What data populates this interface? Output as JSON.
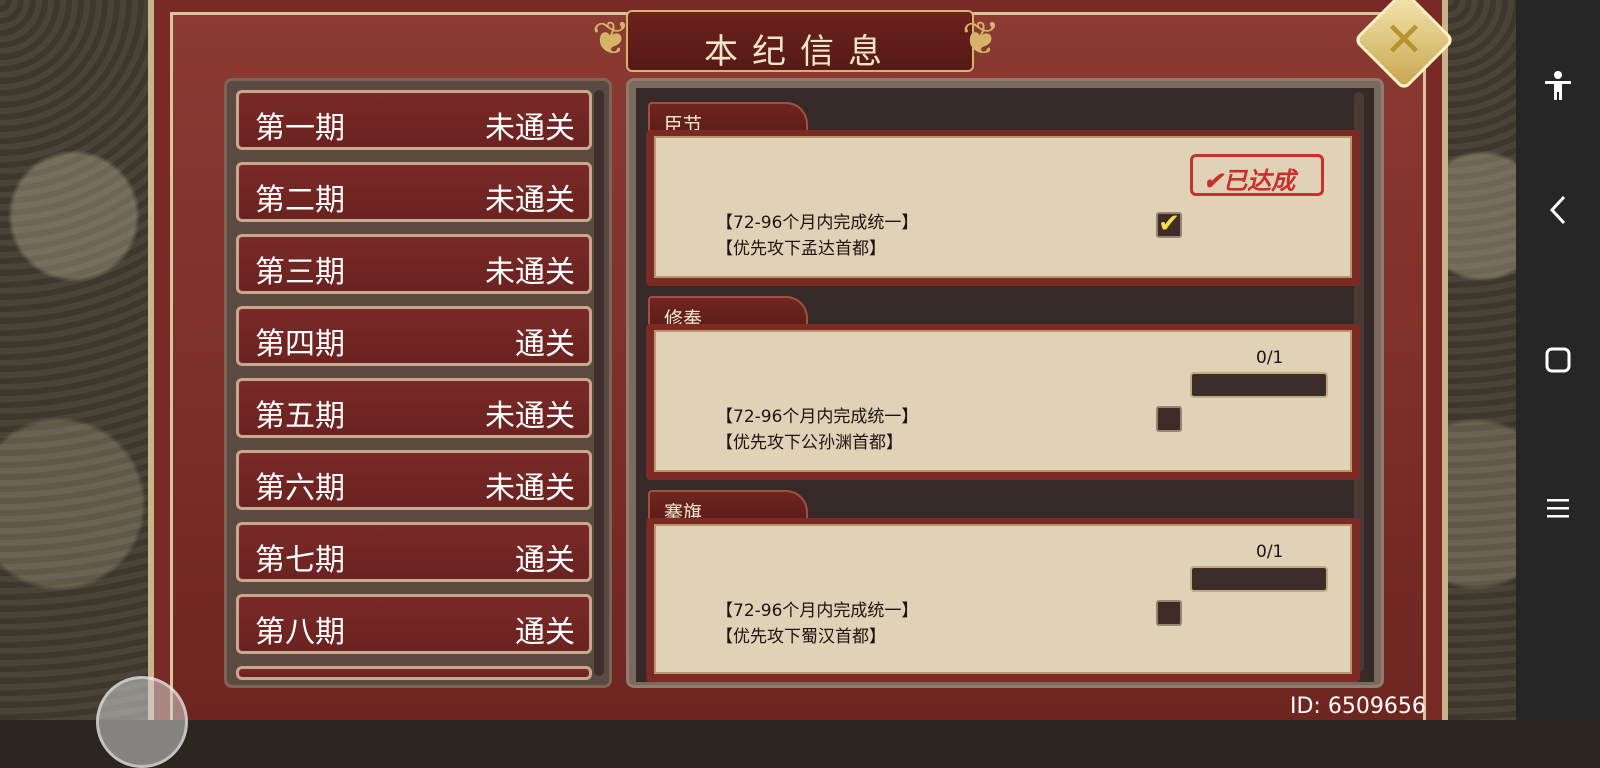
{
  "title": "本纪信息",
  "periods": [
    {
      "name": "第一期",
      "status": "未通关"
    },
    {
      "name": "第二期",
      "status": "未通关"
    },
    {
      "name": "第三期",
      "status": "未通关"
    },
    {
      "name": "第四期",
      "status": "通关"
    },
    {
      "name": "第五期",
      "status": "未通关"
    },
    {
      "name": "第六期",
      "status": "未通关"
    },
    {
      "name": "第七期",
      "status": "通关"
    },
    {
      "name": "第八期",
      "status": "通关"
    }
  ],
  "objectives": [
    {
      "tab": "臣节",
      "line1": "【72-96个月内完成统一】",
      "line2": "【优先攻下孟达首都】",
      "achieved": true,
      "stamp_text": "✔已达成"
    },
    {
      "tab": "修奉",
      "line1": "【72-96个月内完成统一】",
      "line2": "【优先攻下公孙渊首都】",
      "achieved": false,
      "progress_text": "0/1",
      "progress_fraction": 0
    },
    {
      "tab": "搴旗",
      "line1": "【72-96个月内完成统一】",
      "line2": "【优先攻下蜀汉首都】",
      "achieved": false,
      "progress_text": "0/1",
      "progress_fraction": 0
    }
  ],
  "user_id": "ID: 6509656",
  "icons": {
    "close": "close-icon",
    "accessibility": "accessibility-icon",
    "back": "back-icon",
    "home": "home-icon",
    "recents": "recents-icon"
  }
}
